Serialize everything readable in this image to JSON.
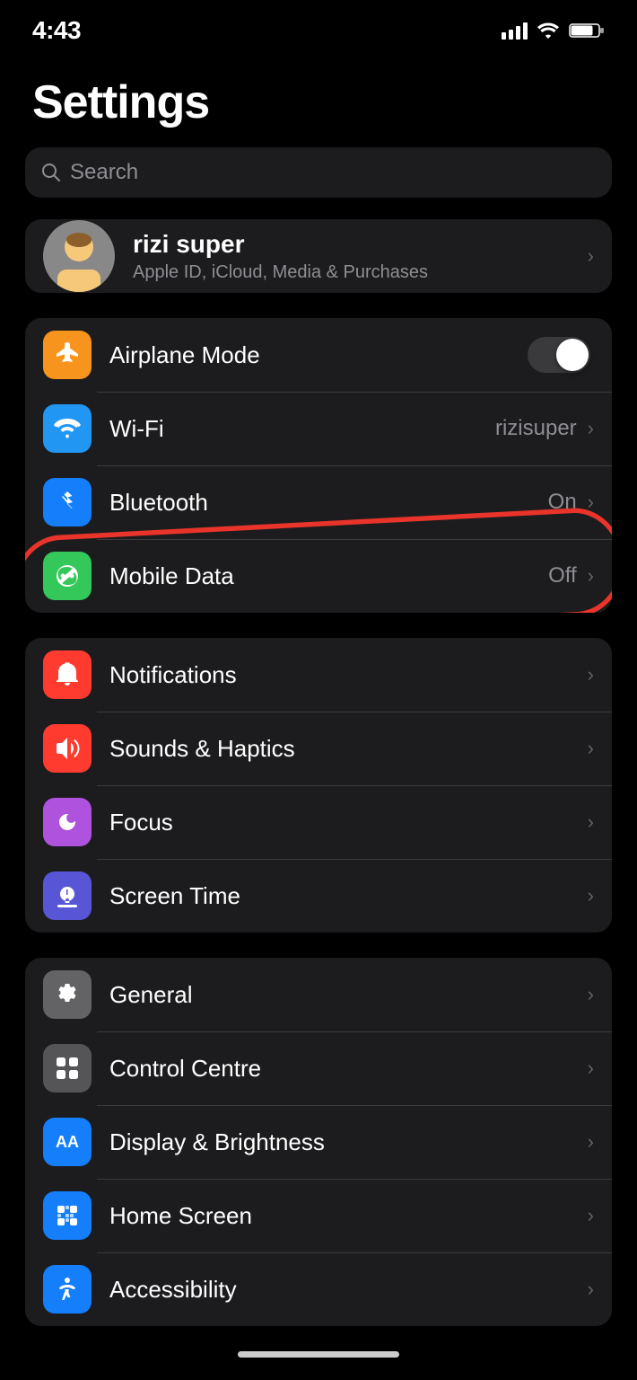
{
  "statusBar": {
    "time": "4:43"
  },
  "page": {
    "title": "Settings",
    "searchPlaceholder": "Search"
  },
  "profile": {
    "name": "rizi super",
    "subtitle": "Apple ID, iCloud, Media & Purchases",
    "avatarEmoji": "👦"
  },
  "connectivityGroup": [
    {
      "id": "airplane-mode",
      "label": "Airplane Mode",
      "icon": "✈",
      "iconBg": "orange",
      "hasToggle": true,
      "toggleOn": false,
      "value": "",
      "hasChevron": false
    },
    {
      "id": "wifi",
      "label": "Wi-Fi",
      "icon": "📶",
      "iconBg": "blue",
      "hasToggle": false,
      "value": "rizisuper",
      "hasChevron": true
    },
    {
      "id": "bluetooth",
      "label": "Bluetooth",
      "icon": "🔷",
      "iconBg": "blue2",
      "hasToggle": false,
      "value": "On",
      "hasChevron": true
    },
    {
      "id": "mobile-data",
      "label": "Mobile Data",
      "icon": "📡",
      "iconBg": "green",
      "hasToggle": false,
      "value": "Off",
      "hasChevron": true,
      "annotated": true
    }
  ],
  "notificationsGroup": [
    {
      "id": "notifications",
      "label": "Notifications",
      "icon": "🔔",
      "iconBg": "red",
      "hasChevron": true
    },
    {
      "id": "sounds-haptics",
      "label": "Sounds & Haptics",
      "icon": "🔊",
      "iconBg": "red2",
      "hasChevron": true
    },
    {
      "id": "focus",
      "label": "Focus",
      "icon": "🌙",
      "iconBg": "purple",
      "hasChevron": true
    },
    {
      "id": "screen-time",
      "label": "Screen Time",
      "icon": "⏱",
      "iconBg": "indigo",
      "hasChevron": true
    }
  ],
  "generalGroup": [
    {
      "id": "general",
      "label": "General",
      "icon": "⚙",
      "iconBg": "gray",
      "hasChevron": true
    },
    {
      "id": "control-centre",
      "label": "Control Centre",
      "icon": "⊞",
      "iconBg": "gray2",
      "hasChevron": true
    },
    {
      "id": "display-brightness",
      "label": "Display & Brightness",
      "icon": "AA",
      "iconBg": "blue3",
      "hasChevron": true,
      "iconIsText": true
    },
    {
      "id": "home-screen",
      "label": "Home Screen",
      "icon": "⠿",
      "iconBg": "blue3",
      "hasChevron": true
    },
    {
      "id": "accessibility",
      "label": "Accessibility",
      "icon": "♿",
      "iconBg": "blue3",
      "hasChevron": true
    }
  ]
}
